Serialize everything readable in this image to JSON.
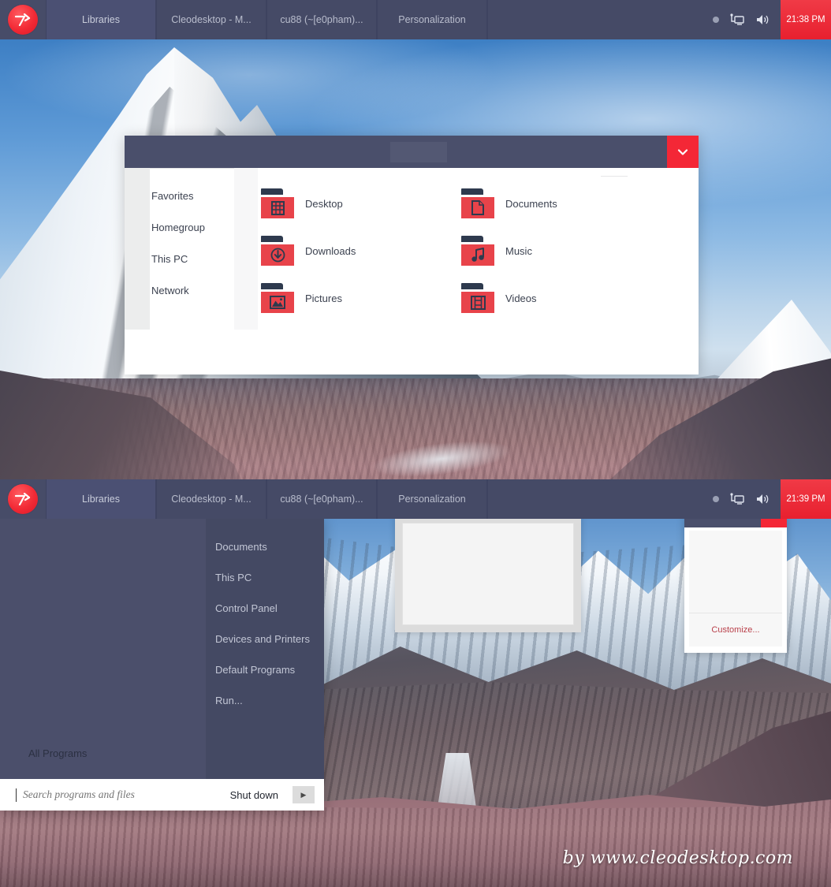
{
  "theme": {
    "accent_red": "#f42736",
    "taskbar_bg": "#454a66",
    "startmenu_left_bg": "#4b4f6b",
    "startmenu_right_bg": "#444963",
    "folder_red": "#e8434a",
    "glyph_navy": "#2e3a4e"
  },
  "taskbar_top": {
    "start_button_label": "7",
    "buttons": [
      {
        "label": "Libraries",
        "active": true
      },
      {
        "label": "Cleodesktop - M...",
        "active": false
      },
      {
        "label": "cu88 (~[e0pham)...",
        "active": false
      },
      {
        "label": "Personalization",
        "active": false
      }
    ],
    "tray": {
      "hidden_icons": "show-hidden-icons-dot",
      "network": "network-icon",
      "volume": "volume-icon"
    },
    "clock": "21:38 PM"
  },
  "taskbar_bottom": {
    "start_button_label": "7",
    "buttons": [
      {
        "label": "Libraries",
        "active": true
      },
      {
        "label": "Cleodesktop - M...",
        "active": false
      },
      {
        "label": "cu88 (~[e0pham)...",
        "active": false
      },
      {
        "label": "Personalization",
        "active": false
      }
    ],
    "tray": {
      "hidden_icons": "show-hidden-icons-dot",
      "network": "network-icon",
      "volume": "volume-icon"
    },
    "clock": "21:39 PM"
  },
  "explorer": {
    "title": "",
    "chevron_label": "⌄",
    "nav_items": [
      {
        "label": "Favorites"
      },
      {
        "label": "Homegroup"
      },
      {
        "label": "This PC"
      },
      {
        "label": "Network"
      }
    ],
    "files": [
      {
        "label": "Desktop",
        "icon": "desktop-folder-icon"
      },
      {
        "label": "Documents",
        "icon": "documents-folder-icon"
      },
      {
        "label": "Downloads",
        "icon": "downloads-folder-icon"
      },
      {
        "label": "Music",
        "icon": "music-folder-icon"
      },
      {
        "label": "Pictures",
        "icon": "pictures-folder-icon"
      },
      {
        "label": "Videos",
        "icon": "videos-folder-icon"
      }
    ]
  },
  "customize_window": {
    "link_label": "Customize..."
  },
  "start_menu": {
    "right_items": [
      {
        "label": "Documents"
      },
      {
        "label": "This PC"
      },
      {
        "label": "Control Panel"
      },
      {
        "label": "Devices and Printers"
      },
      {
        "label": "Default Programs"
      },
      {
        "label": "Run..."
      }
    ],
    "all_programs_label": "All Programs",
    "search_placeholder": "Search programs and files",
    "search_value": "",
    "shutdown_label": "Shut down",
    "shutdown_arrow": "▶"
  },
  "watermark": {
    "text": "by  www.cleodesktop.com"
  }
}
